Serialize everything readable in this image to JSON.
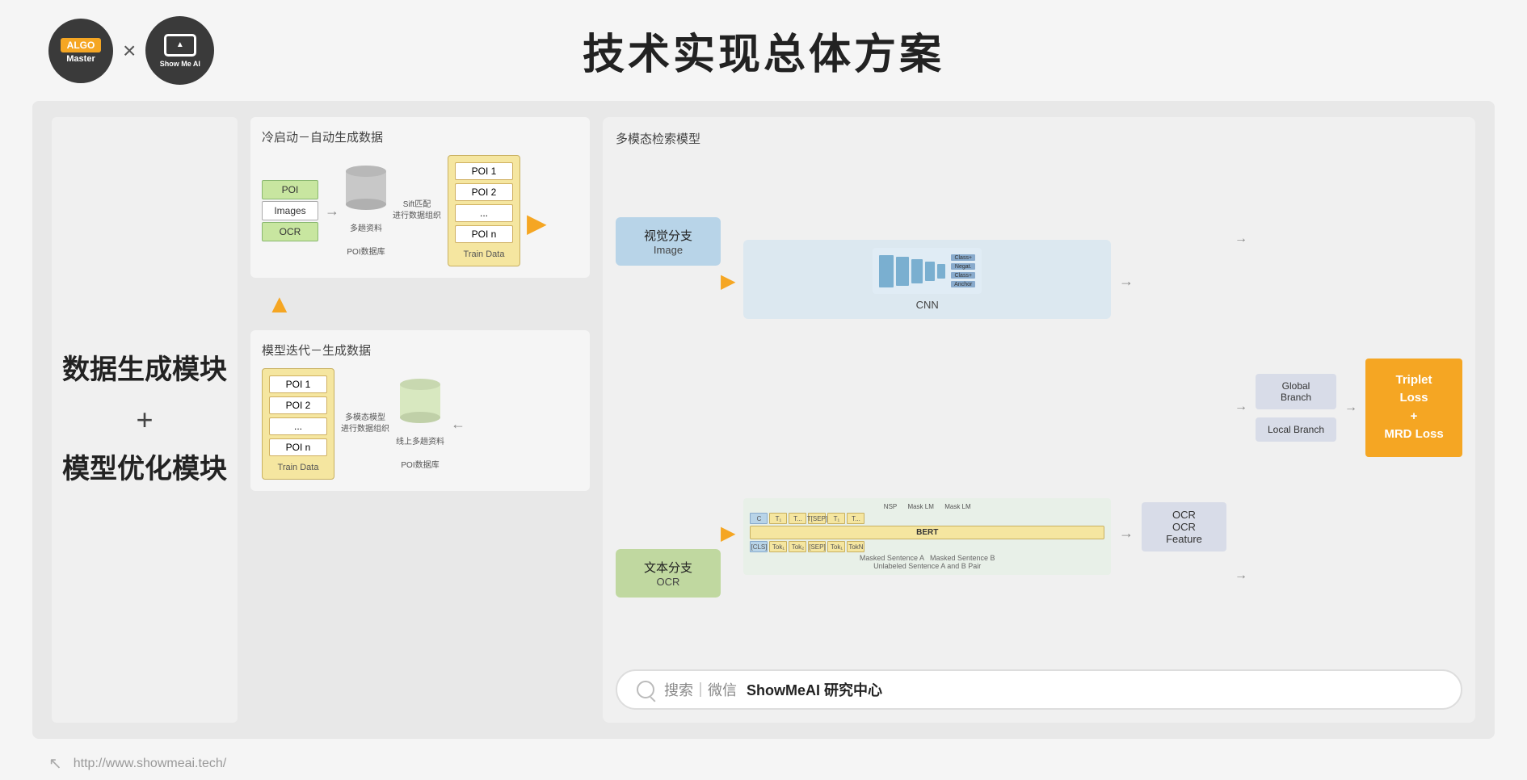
{
  "header": {
    "title": "技术实现总体方案",
    "algo_label_top": "ALGO",
    "algo_label_bot": "Master",
    "showme_text": "Show Me AI",
    "x_mark": "×"
  },
  "left_panel": {
    "title1": "数据生成模块",
    "plus": "+",
    "title2": "模型优化模块"
  },
  "cold_start": {
    "section_title": "冷启动－自动生成数据",
    "poi_label": "POI",
    "images_label": "Images",
    "ocr_label": "OCR",
    "db_label1": "多趟资料",
    "db_label2": "POI数据库",
    "sift_label1": "Sift匹配",
    "sift_label2": "进行数据组织",
    "poi_items": [
      "POI 1",
      "POI 2",
      "...",
      "POI n"
    ],
    "train_data_label": "Train Data"
  },
  "model_iter": {
    "section_title": "模型迭代－生成数据",
    "poi_items": [
      "POI 1",
      "POI 2",
      "...",
      "POI n"
    ],
    "train_data_label": "Train Data",
    "db_label1": "线上多趟资料",
    "db_label2": "POI数据库",
    "multi_label1": "多模态模型",
    "multi_label2": "进行数据组织"
  },
  "multimodal": {
    "section_title": "多模态检索模型",
    "visual_branch_label": "视觉分支",
    "image_label": "Image",
    "text_branch_label": "文本分支",
    "ocr_label": "OCR",
    "cnn_label": "CNN",
    "bert_label": "BERT",
    "global_branch": "Global Branch",
    "local_branch": "Local Branch",
    "ocr_feature": "OCR Feature",
    "loss_line1": "Triplet Loss",
    "loss_plus": "+",
    "loss_line2": "MRD Loss"
  },
  "search_bar": {
    "prefix": "搜索｜微信",
    "brand": "ShowMeAI 研究中心"
  },
  "footer": {
    "url": "http://www.showmeai.tech/"
  }
}
